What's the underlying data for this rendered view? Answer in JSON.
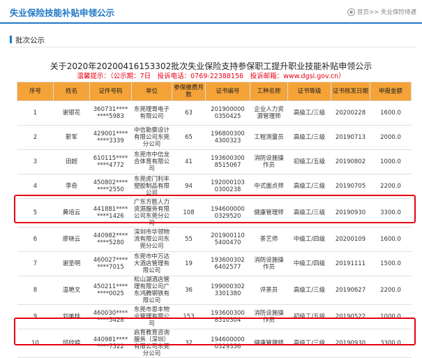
{
  "header": {
    "title": "失业保险技能补贴申领公示",
    "breadcrumb": "首页>> 失业保险待遇"
  },
  "section": {
    "label": "批次公示"
  },
  "notice": {
    "title": "关于2020年20200416153302批次失业保险支持参保职工提升职业技能补贴申领公示",
    "warning": "温馨提示：（公示期：7日　投诉电话：0769-22388156　投诉邮箱：www.dgsi.gov.cn）"
  },
  "table": {
    "headers": [
      "序号",
      "姓名",
      "证件号码",
      "单位",
      "参保缴费月数",
      "证书编号",
      "工种名称",
      "证书等级",
      "证书核发日期",
      "申报金额"
    ],
    "rows": [
      [
        "1",
        "谢银花",
        "360731**** ****5983",
        "东莞理哥电子有限公司",
        "63",
        "201900000 0350425",
        "企业人力资源管理师",
        "高级工/三级",
        "20200228",
        "1600.0"
      ],
      [
        "2",
        "靳军",
        "429001**** ****3339",
        "中信勘察设计有限公司东莞分公司",
        "65",
        "196800300 4300323",
        "工程测量员",
        "高级工/三级",
        "20190713",
        "2000.0"
      ],
      [
        "3",
        "田超",
        "610115**** ****4772",
        "东莞市中信龙合体育有限公司",
        "41",
        "193600300 8515067",
        "消防设施操作员",
        "初级工/五级",
        "20190802",
        "1000.0"
      ],
      [
        "4",
        "李奇",
        "450802**** ****2550",
        "东莞虎门利丰塑胶制品有限公司",
        "94",
        "192000103 0300238",
        "中式面点师",
        "高级工/三级",
        "20190705",
        "2200.0"
      ],
      [
        "5",
        "黄培云",
        "441881**** ****1426",
        "广东方胜人力资源服务有限公司东莞分公司",
        "108",
        "194600000 0329520",
        "健康管理师",
        "高级工/三级",
        "20190930",
        "3300.0"
      ],
      [
        "6",
        "廖晓云",
        "440982**** ****5280",
        "深圳市华领物流有限公司东莞分公司",
        "55",
        "201900110 5400470",
        "茶艺师",
        "中级工/四级",
        "20200109",
        "1600.0"
      ],
      [
        "7",
        "谢圣明",
        "460027**** ****7015",
        "东莞市中万达大酒店管理有限公司",
        "19",
        "193600302 6402577",
        "消防设施操作员",
        "中级工/四级",
        "20191111",
        "1500.0"
      ],
      [
        "8",
        "温艳文",
        "450211**** ****0025",
        "松山湖酒店管理有限公司广东鸿腾钢铁有限公司",
        "36",
        "199000302 3301380",
        "评茶员",
        "高级工/三级",
        "20190627",
        "2200.0"
      ],
      [
        "9",
        "刘美桂",
        "460030**** ****5428",
        "东莞市恩丰物业管理有限公司",
        "153",
        "193600300 8510304",
        "消防设施操作员",
        "初级工/五级",
        "20190522",
        "1000.0"
      ],
      [
        "10",
        "邱欣婷",
        "440981**** ****7522",
        "启育教育咨询服务（深圳）有限公司东莞分公司",
        "32",
        "194600000 0329356",
        "健康管理师",
        "高级工/三级",
        "20190930",
        "3300.0"
      ]
    ]
  }
}
